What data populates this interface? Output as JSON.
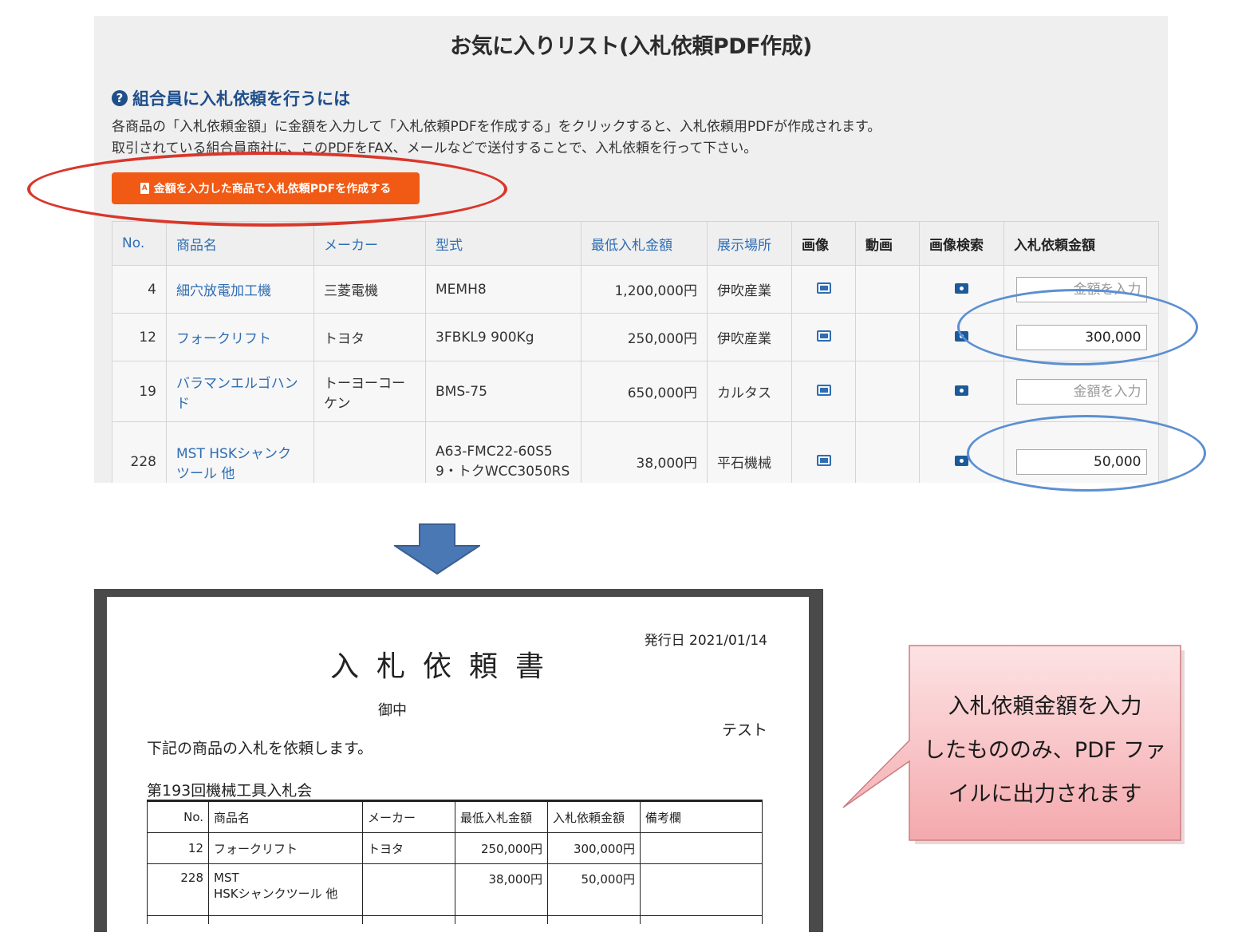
{
  "panel": {
    "title": "お気に入りリスト(入札依頼PDF作成)",
    "help_icon": "?",
    "help_heading": "組合員に入札依頼を行うには",
    "help_line1": "各商品の「入札依頼金額」に金額を入力して「入札依頼PDFを作成する」をクリックすると、入札依頼用PDFが作成されます。",
    "help_line2": "取引されている組合員商社に、このPDFをFAX、メールなどで送付することで、入札依頼を行って下さい。",
    "pdf_button_label": "金額を入力した商品で入札依頼PDFを作成する",
    "pdf_icon_glyph": "A",
    "table": {
      "headers": {
        "no": "No.",
        "name": "商品名",
        "maker": "メーカー",
        "model": "型式",
        "min_bid": "最低入札金額",
        "location": "展示場所",
        "image": "画像",
        "video": "動画",
        "image_search": "画像検索",
        "bid_amount": "入札依頼金額"
      },
      "rows": [
        {
          "no": "4",
          "name": "細穴放電加工機",
          "maker": "三菱電機",
          "model": "MEMH8",
          "min_bid": "1,200,000円",
          "location": "伊吹産業",
          "bid_value": ""
        },
        {
          "no": "12",
          "name": "フォークリフト",
          "maker": "トヨタ",
          "model": "3FBKL9 900Kg",
          "min_bid": "250,000円",
          "location": "伊吹産業",
          "bid_value": "300,000"
        },
        {
          "no": "19",
          "name": "バラマンエルゴハンド",
          "maker": "トーヨーコーケン",
          "model": "BMS-75",
          "min_bid": "650,000円",
          "location": "カルタス",
          "bid_value": ""
        },
        {
          "no": "228",
          "name": "MST HSKシャンクツール 他",
          "maker": "",
          "model": "A63-FMC22-60S59・トクWCC3050RS",
          "min_bid": "38,000円",
          "location": "平石機械",
          "bid_value": "50,000"
        }
      ],
      "bid_placeholder": "金額を入力"
    }
  },
  "pdf": {
    "date": "発行日 2021/01/14",
    "title": "入札依頼書",
    "to": "御中",
    "from": "テスト",
    "body": "下記の商品の入札を依頼します。",
    "sale_name": "第193回機械工具入札会",
    "headers": {
      "no": "No.",
      "name": "商品名",
      "maker": "メーカー",
      "min_bid": "最低入札金額",
      "bid_amount": "入札依頼金額",
      "remarks": "備考欄"
    },
    "rows": [
      {
        "no": "12",
        "name": "フォークリフト",
        "maker": "トヨタ",
        "min_bid": "250,000円",
        "bid_amount": "300,000円",
        "remarks": ""
      },
      {
        "no": "228",
        "name_line1": "MST",
        "name_line2": "HSKシャンクツール 他",
        "maker": "",
        "min_bid": "38,000円",
        "bid_amount": "50,000円",
        "remarks": ""
      }
    ]
  },
  "callout": {
    "line1": "入札依頼金額を入力",
    "line2": "したもののみ、PDF ファ",
    "line3": "イルに出力されます"
  },
  "colors": {
    "accent_orange": "#f05a14",
    "link_blue": "#2e6db3",
    "highlight_red": "#d9372b",
    "highlight_blue": "#5c8fd1",
    "arrow_blue": "#4a78b5",
    "callout_pink": "#f7b8bb"
  },
  "icons": {
    "help": "question-circle-icon",
    "pdf": "pdf-file-icon",
    "image": "image-gallery-icon",
    "camera": "camera-icon",
    "arrow": "down-arrow-icon"
  }
}
